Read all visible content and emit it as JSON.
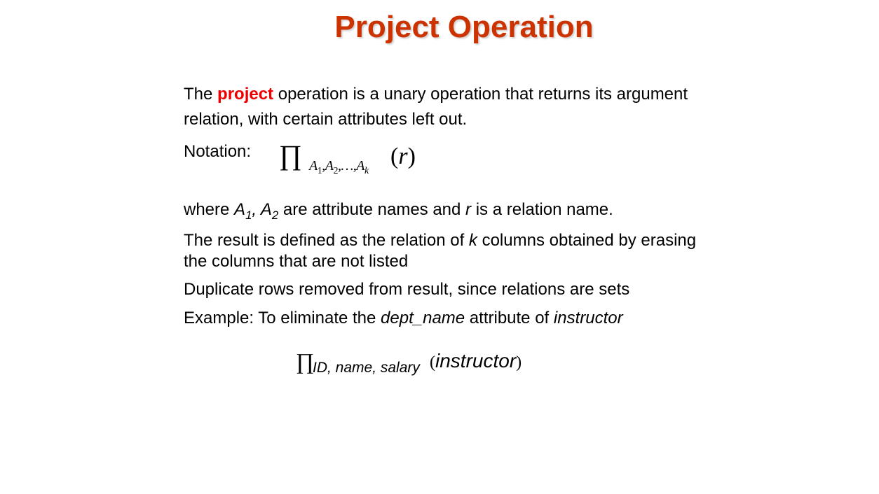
{
  "slide": {
    "title": "Project Operation",
    "intro": {
      "before": "The ",
      "keyword": "project",
      "after_line1": " operation is a unary operation that returns its argument",
      "line2": "relation, with certain attributes left out."
    },
    "notation": {
      "label": "Notation:",
      "symbol": "∏",
      "subscript_a1": "A",
      "subscript_1": "1",
      "subscript_a2": ",A",
      "subscript_2": "2",
      "subscript_dots": ",…,A",
      "subscript_k": "k",
      "argument_open": "(",
      "argument": "r",
      "argument_close": ")"
    },
    "where_line": {
      "prefix": "where ",
      "a1": "A",
      "a1_sub": "1",
      "comma": ", ",
      "a2": "A",
      "a2_sub": "2",
      "mid": " are attribute names and ",
      "r": "r",
      "end": " is a relation name."
    },
    "result_line": {
      "before": "The result is defined as the relation of ",
      "k": "k",
      "after": " columns obtained by erasing",
      "line2": "the columns that are not listed"
    },
    "duplicates_line": "Duplicate rows removed from result, since relations are sets",
    "example_line": {
      "prefix": "Example: To eliminate the ",
      "attr": "dept_name",
      "mid": " attribute of ",
      "rel": "instructor"
    },
    "example_expr": {
      "symbol": "∏",
      "subscript": "ID, name, salary",
      "open": "(",
      "argument": "instructor",
      "close": ")"
    }
  }
}
